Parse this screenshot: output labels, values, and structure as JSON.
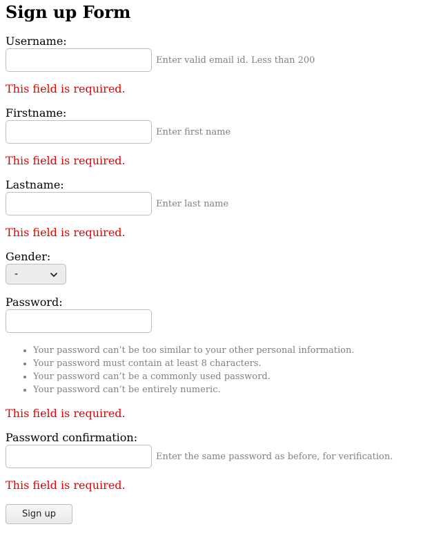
{
  "page": {
    "title": "Sign up Form"
  },
  "form": {
    "username": {
      "label": "Username:",
      "value": "",
      "help": "Enter valid email id. Less than 200",
      "error": "This field is required."
    },
    "firstname": {
      "label": "Firstname:",
      "value": "",
      "help": "Enter first name",
      "error": "This field is required."
    },
    "lastname": {
      "label": "Lastname:",
      "value": "",
      "help": "Enter last name",
      "error": "This field is required."
    },
    "gender": {
      "label": "Gender:",
      "selected": "-"
    },
    "password": {
      "label": "Password:",
      "value": "",
      "rules": [
        "Your password can’t be too similar to your other personal information.",
        "Your password must contain at least 8 characters.",
        "Your password can’t be a commonly used password.",
        "Your password can’t be entirely numeric."
      ],
      "error": "This field is required."
    },
    "password_confirmation": {
      "label": "Password confirmation:",
      "value": "",
      "help": "Enter the same password as before, for verification.",
      "error": "This field is required."
    },
    "submit_label": "Sign up"
  },
  "colors": {
    "error": "#e60000",
    "help_text": "#808080",
    "input_border": "#bdbdbd"
  },
  "icons": {
    "select_arrow": "chevron-down-icon"
  }
}
